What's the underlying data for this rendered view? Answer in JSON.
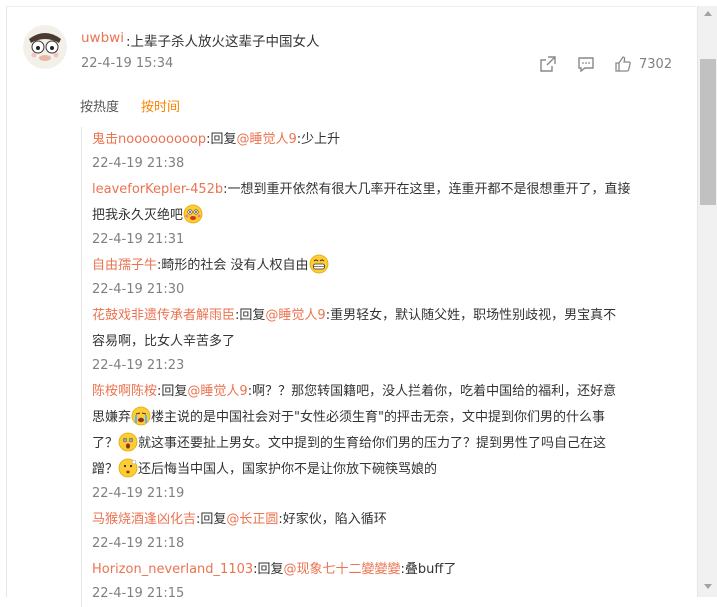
{
  "post": {
    "username": "uwbwi",
    "text": ":上辈子杀人放火这辈子中国女人",
    "time": "22-4-19 15:34",
    "like_count": "7302"
  },
  "sort": {
    "hot": "按热度",
    "time": "按时间"
  },
  "replies": [
    {
      "name": "鬼击nooooooooop",
      "prefix": ":回复",
      "mention": "@睡觉人9",
      "text": ":少上升",
      "time": "22-4-19 21:38"
    },
    {
      "name": "leaveforKepler-452b",
      "text": ":一想到重开依然有很大几率开在这里，连重开都不是很想重开了，直接",
      "text2": "把我永久灭绝吧",
      "time": "22-4-19 21:31"
    },
    {
      "name": "自由孺子牛",
      "text": ":畸形的社会 没有人权自由",
      "time": "22-4-19 21:30"
    },
    {
      "name": "花鼓戏非遗传承者解雨臣",
      "prefix": ":回复",
      "mention": "@睡觉人9",
      "text": ":重男轻女，默认随父姓，职场性别歧视，男宝真不",
      "text2": "容易啊，比女人辛苦多了",
      "time": "22-4-19 21:23"
    },
    {
      "name": "陈桉啊陈桉",
      "prefix": ":回复",
      "mention": "@睡觉人9",
      "text": ":啊？？那您转国籍吧，没人拦着你，吃着中国给的福利，还好意",
      "text2a": "思嫌弃",
      "text2b": "楼主说的是中国社会对于\"女性必须生育\"的抨击无奈，文中提到你们男的什么事",
      "text3a": "了？",
      "text3b": "就这事还要扯上男女。文中提到的生育给你们男的压力了？提到男性了吗自己在这",
      "text4a": "蹭？",
      "text4b": "还后悔当中国人，国家护你不是让你放下碗筷骂娘的",
      "time": "22-4-19 21:19"
    },
    {
      "name": "马猴烧酒逢凶化吉",
      "prefix": ":回复",
      "mention": "@长正圆",
      "text": ":好家伙，陷入循环",
      "time": "22-4-19 21:18"
    },
    {
      "name": "Horizon_neverland_1103",
      "prefix": ":回复",
      "mention": "@现象七十二變變變",
      "text": ":叠buff了",
      "time": "22-4-19 21:15"
    }
  ]
}
